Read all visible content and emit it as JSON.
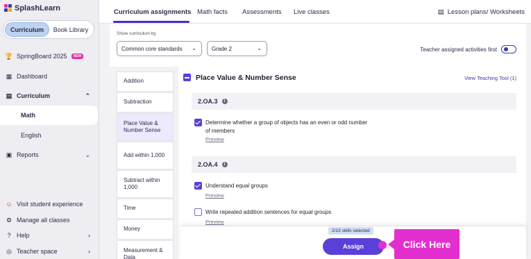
{
  "app": {
    "logo_text": "SplashLearn"
  },
  "sidebar": {
    "segment": {
      "curriculum": "Curriculum",
      "book_library": "Book Library"
    },
    "springboard": {
      "label": "SpringBoard 2025",
      "badge": "NEW"
    },
    "dashboard": "Dashboard",
    "curriculum": "Curriculum",
    "sub": {
      "math": "Math",
      "english": "English"
    },
    "reports": "Reports",
    "visit": "Visit student experience",
    "manage": "Manage all classes",
    "help": "Help",
    "teacher_space": "Teacher space"
  },
  "tabs": {
    "items": [
      "Curriculum assignments",
      "Math facts",
      "Assessments",
      "Live classes"
    ],
    "lesson_plans": "Lesson plans/ Worksheets"
  },
  "filters": {
    "label": "Show curriculum by",
    "standard": "Common core standards",
    "grade": "Grade 2",
    "toggle_label": "Teacher assigned activities first"
  },
  "topics": [
    "Addition",
    "Subtraction",
    "Place Value & Number Sense",
    "Add within 1,000",
    "Subtract within 1,000",
    "Time",
    "Money",
    "Measurement & Data"
  ],
  "section": {
    "title": "Place Value & Number Sense",
    "teaching_tool": "View Teaching Tool (1)"
  },
  "standards": [
    {
      "code": "2.OA.3"
    },
    {
      "code": "2.OA.4"
    }
  ],
  "skills": [
    {
      "text": "Determine whether a group of objects has an even or odd number of members",
      "preview": "Preview",
      "checked": true
    },
    {
      "text": "Understand equal groups",
      "preview": "Preview",
      "checked": true
    },
    {
      "text": "Write repeated addition sentences for equal groups",
      "preview": "Preview",
      "checked": false
    }
  ],
  "footer": {
    "skills_selected": "2/13 skills selected",
    "assign": "Assign",
    "callout": "Click Here"
  },
  "colors": {
    "accent": "#5b3fd9",
    "callout": "#e42fd0",
    "new_badge": "#e42fa3"
  }
}
